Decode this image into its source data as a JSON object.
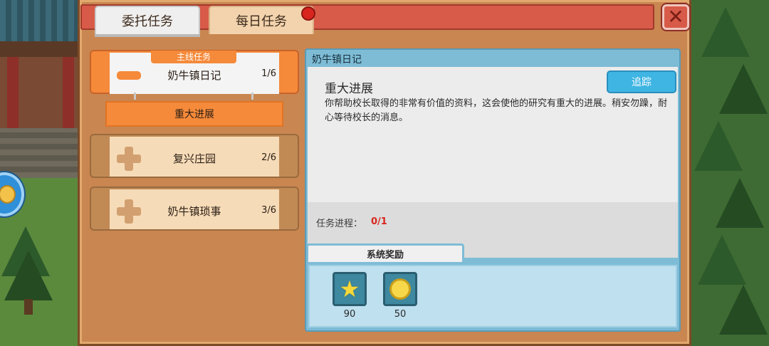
{
  "tabs": [
    {
      "label": "委托任务",
      "active": true
    },
    {
      "label": "每日任务",
      "active": false,
      "has_notification": true
    }
  ],
  "quest_list": {
    "selected": {
      "badge": "主线任务",
      "title": "奶牛镇日记",
      "count": "1/6"
    },
    "sub_item": "重大进展",
    "others": [
      {
        "title": "复兴庄园",
        "count": "2/6"
      },
      {
        "title": "奶牛镇琐事",
        "count": "3/6"
      }
    ]
  },
  "detail": {
    "title": "奶牛镇日记",
    "subtitle": "重大进展",
    "description": "你帮助校长取得的非常有价值的资料，这会使他的研究有重大的进展。稍安勿躁，耐心等待校长的消息。",
    "track_label": "追踪",
    "progress_label": "任务进程：",
    "progress_value": "0/1"
  },
  "rewards": {
    "tab_label": "系统奖励",
    "items": [
      {
        "icon": "star-icon",
        "count": "90"
      },
      {
        "icon": "coin-icon",
        "count": "50"
      }
    ]
  },
  "colors": {
    "accent_orange": "#f58a3a",
    "track_button": "#3fb5e3",
    "close_button": "#d85a48",
    "progress_value": "#d8251e"
  }
}
